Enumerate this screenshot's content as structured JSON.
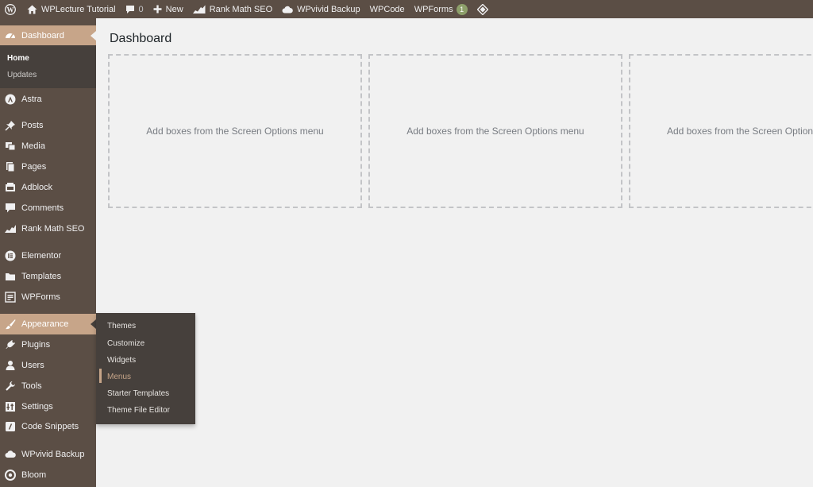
{
  "adminbar": {
    "site_name": "WPLecture Tutorial",
    "comments_count": "0",
    "new_label": "New",
    "rank_math": "Rank Math SEO",
    "wpvivid": "WPvivid Backup",
    "wpcode": "WPCode",
    "wpforms": "WPForms",
    "wpforms_badge": "1",
    "icons": [
      "wordpress-icon",
      "home-icon",
      "comment-icon",
      "plus-icon",
      "chart-icon",
      "cloud-icon",
      "diamond-icon"
    ]
  },
  "sidebar": {
    "dashboard": "Dashboard",
    "dashboard_sub": [
      "Home",
      "Updates"
    ],
    "items": [
      {
        "label": "Astra",
        "icon": "astra-icon"
      },
      {
        "label": "Posts",
        "icon": "pin-icon"
      },
      {
        "label": "Media",
        "icon": "media-icon"
      },
      {
        "label": "Pages",
        "icon": "pages-icon"
      },
      {
        "label": "Adblock",
        "icon": "adblock-icon"
      },
      {
        "label": "Comments",
        "icon": "comment-icon"
      },
      {
        "label": "Rank Math SEO",
        "icon": "chart-icon"
      },
      {
        "label": "Elementor",
        "icon": "elementor-icon"
      },
      {
        "label": "Templates",
        "icon": "folder-icon"
      },
      {
        "label": "WPForms",
        "icon": "form-icon"
      },
      {
        "label": "Appearance",
        "icon": "brush-icon"
      },
      {
        "label": "Plugins",
        "icon": "plug-icon"
      },
      {
        "label": "Users",
        "icon": "user-icon"
      },
      {
        "label": "Tools",
        "icon": "wrench-icon"
      },
      {
        "label": "Settings",
        "icon": "settings-icon"
      },
      {
        "label": "Code Snippets",
        "icon": "code-icon"
      },
      {
        "label": "WPvivid Backup",
        "icon": "cloud-icon"
      },
      {
        "label": "Bloom",
        "icon": "bloom-icon"
      }
    ]
  },
  "flyout": {
    "items": [
      "Themes",
      "Customize",
      "Widgets",
      "Menus",
      "Starter Templates",
      "Theme File Editor"
    ],
    "current": "Menus"
  },
  "main": {
    "title": "Dashboard",
    "box_text": "Add boxes from the Screen Options menu"
  },
  "colors": {
    "chrome": "#5b4e45",
    "accent": "#c7a589",
    "submenu": "#46403c",
    "background": "#f1f1f1"
  }
}
